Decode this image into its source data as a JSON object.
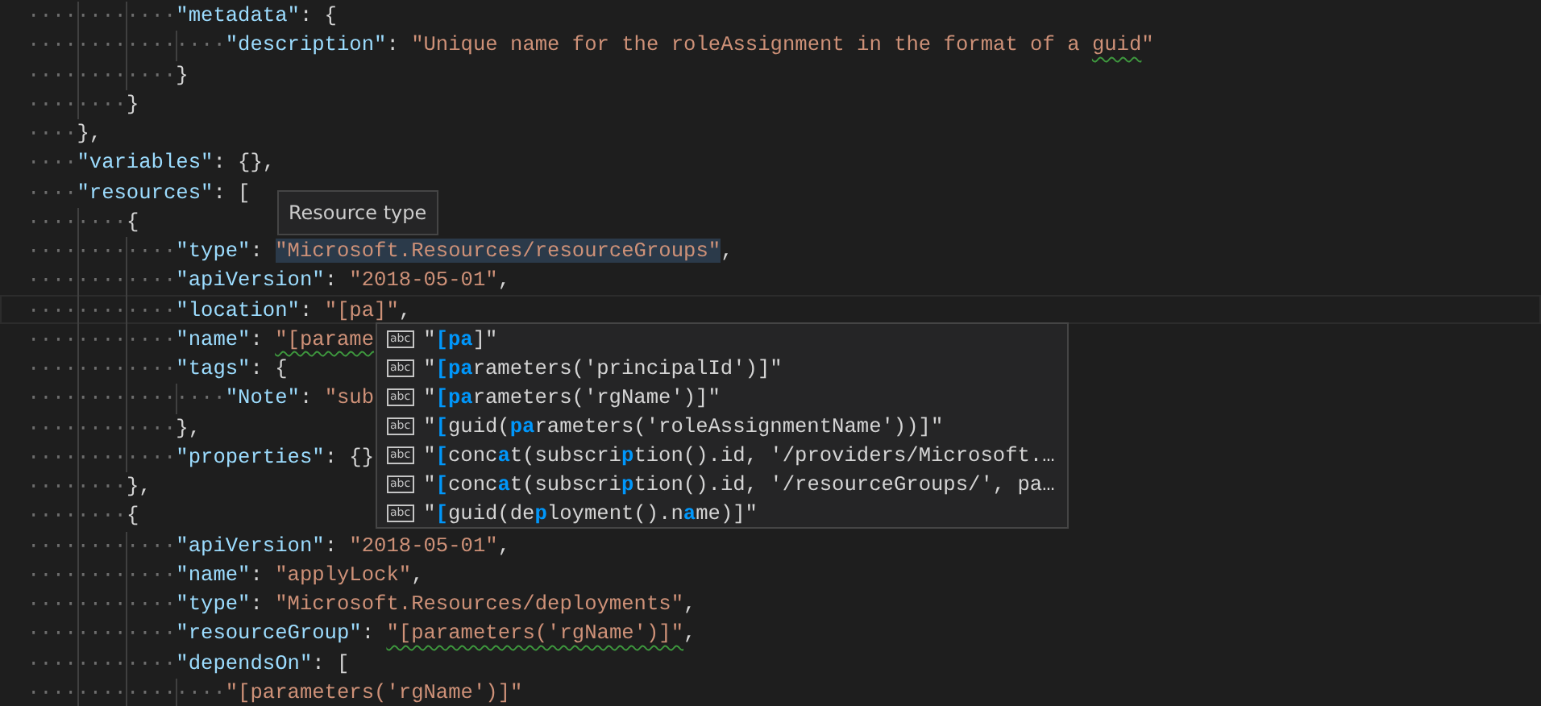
{
  "editor": {
    "lines": [
      {
        "current": false,
        "tokens": [
          {
            "kind": "ws",
            "text": "············"
          },
          {
            "kind": "key",
            "text": "\"metadata\""
          },
          {
            "kind": "punct",
            "text": ": {"
          }
        ]
      },
      {
        "current": false,
        "tokens": [
          {
            "kind": "ws",
            "text": "················"
          },
          {
            "kind": "key",
            "text": "\"description\""
          },
          {
            "kind": "punct",
            "text": ": "
          },
          {
            "kind": "string",
            "text": "\"Unique name for the roleAssignment in the format of a "
          },
          {
            "kind": "string",
            "text": "guid",
            "squiggle": true
          },
          {
            "kind": "string",
            "text": "\""
          }
        ]
      },
      {
        "current": false,
        "tokens": [
          {
            "kind": "ws",
            "text": "············"
          },
          {
            "kind": "punct",
            "text": "}"
          }
        ]
      },
      {
        "current": false,
        "tokens": [
          {
            "kind": "ws",
            "text": "········"
          },
          {
            "kind": "punct",
            "text": "}"
          }
        ]
      },
      {
        "current": false,
        "tokens": [
          {
            "kind": "ws",
            "text": "····"
          },
          {
            "kind": "punct",
            "text": "},"
          }
        ]
      },
      {
        "current": false,
        "tokens": [
          {
            "kind": "ws",
            "text": "····"
          },
          {
            "kind": "key",
            "text": "\"variables\""
          },
          {
            "kind": "punct",
            "text": ": {},"
          }
        ]
      },
      {
        "current": false,
        "tokens": [
          {
            "kind": "ws",
            "text": "····"
          },
          {
            "kind": "key",
            "text": "\"resources\""
          },
          {
            "kind": "punct",
            "text": ": ["
          }
        ]
      },
      {
        "current": false,
        "tokens": [
          {
            "kind": "ws",
            "text": "········"
          },
          {
            "kind": "punct",
            "text": "{"
          }
        ]
      },
      {
        "current": false,
        "tokens": [
          {
            "kind": "ws",
            "text": "············"
          },
          {
            "kind": "key",
            "text": "\"type\""
          },
          {
            "kind": "punct",
            "text": ": "
          },
          {
            "kind": "string",
            "text": "\"Microsoft.Resources/resourceGroups\"",
            "highlighted": true
          },
          {
            "kind": "punct",
            "text": ","
          }
        ]
      },
      {
        "current": false,
        "tokens": [
          {
            "kind": "ws",
            "text": "············"
          },
          {
            "kind": "key",
            "text": "\"apiVersion\""
          },
          {
            "kind": "punct",
            "text": ": "
          },
          {
            "kind": "string",
            "text": "\"2018-05-01\""
          },
          {
            "kind": "punct",
            "text": ","
          }
        ]
      },
      {
        "current": true,
        "tokens": [
          {
            "kind": "ws",
            "text": "············"
          },
          {
            "kind": "key",
            "text": "\"location\""
          },
          {
            "kind": "punct",
            "text": ": "
          },
          {
            "kind": "string",
            "text": "\"[pa]\""
          },
          {
            "kind": "punct",
            "text": ","
          }
        ]
      },
      {
        "current": false,
        "tokens": [
          {
            "kind": "ws",
            "text": "············"
          },
          {
            "kind": "key",
            "text": "\"name\""
          },
          {
            "kind": "punct",
            "text": ": "
          },
          {
            "kind": "string",
            "text": "\"[parame",
            "squiggle": true
          }
        ]
      },
      {
        "current": false,
        "tokens": [
          {
            "kind": "ws",
            "text": "············"
          },
          {
            "kind": "key",
            "text": "\"tags\""
          },
          {
            "kind": "punct",
            "text": ": {"
          }
        ]
      },
      {
        "current": false,
        "tokens": [
          {
            "kind": "ws",
            "text": "················"
          },
          {
            "kind": "key",
            "text": "\"Note\""
          },
          {
            "kind": "punct",
            "text": ": "
          },
          {
            "kind": "string",
            "text": "\"sub"
          }
        ]
      },
      {
        "current": false,
        "tokens": [
          {
            "kind": "ws",
            "text": "············"
          },
          {
            "kind": "punct",
            "text": "},"
          }
        ]
      },
      {
        "current": false,
        "tokens": [
          {
            "kind": "ws",
            "text": "············"
          },
          {
            "kind": "key",
            "text": "\"properties\""
          },
          {
            "kind": "punct",
            "text": ": {}"
          }
        ]
      },
      {
        "current": false,
        "tokens": [
          {
            "kind": "ws",
            "text": "········"
          },
          {
            "kind": "punct",
            "text": "},"
          }
        ]
      },
      {
        "current": false,
        "tokens": [
          {
            "kind": "ws",
            "text": "········"
          },
          {
            "kind": "punct",
            "text": "{"
          }
        ]
      },
      {
        "current": false,
        "tokens": [
          {
            "kind": "ws",
            "text": "············"
          },
          {
            "kind": "key",
            "text": "\"apiVersion\""
          },
          {
            "kind": "punct",
            "text": ": "
          },
          {
            "kind": "string",
            "text": "\"2018-05-01\""
          },
          {
            "kind": "punct",
            "text": ","
          }
        ]
      },
      {
        "current": false,
        "tokens": [
          {
            "kind": "ws",
            "text": "············"
          },
          {
            "kind": "key",
            "text": "\"name\""
          },
          {
            "kind": "punct",
            "text": ": "
          },
          {
            "kind": "string",
            "text": "\"applyLock\""
          },
          {
            "kind": "punct",
            "text": ","
          }
        ]
      },
      {
        "current": false,
        "tokens": [
          {
            "kind": "ws",
            "text": "············"
          },
          {
            "kind": "key",
            "text": "\"type\""
          },
          {
            "kind": "punct",
            "text": ": "
          },
          {
            "kind": "string",
            "text": "\"Microsoft.Resources/deployments\""
          },
          {
            "kind": "punct",
            "text": ","
          }
        ]
      },
      {
        "current": false,
        "tokens": [
          {
            "kind": "ws",
            "text": "············"
          },
          {
            "kind": "key",
            "text": "\"resourceGroup\""
          },
          {
            "kind": "punct",
            "text": ": "
          },
          {
            "kind": "string",
            "text": "\"[parameters('rgName')]\"",
            "squiggle": true
          },
          {
            "kind": "punct",
            "text": ","
          }
        ]
      },
      {
        "current": false,
        "tokens": [
          {
            "kind": "ws",
            "text": "············"
          },
          {
            "kind": "key",
            "text": "\"dependsOn\""
          },
          {
            "kind": "punct",
            "text": ": ["
          }
        ]
      },
      {
        "current": false,
        "tokens": [
          {
            "kind": "ws",
            "text": "················"
          },
          {
            "kind": "string",
            "text": "\"[parameters('rgName')]\""
          }
        ]
      }
    ]
  },
  "hover_tooltip": {
    "text": "Resource type"
  },
  "suggestions": [
    {
      "icon": "abc",
      "parts": [
        {
          "text": "\"",
          "match": false
        },
        {
          "text": "[pa",
          "match": true
        },
        {
          "text": "]\"",
          "match": false
        }
      ]
    },
    {
      "icon": "abc",
      "parts": [
        {
          "text": "\"",
          "match": false
        },
        {
          "text": "[pa",
          "match": true
        },
        {
          "text": "rameters('principalId')]\"",
          "match": false
        }
      ]
    },
    {
      "icon": "abc",
      "parts": [
        {
          "text": "\"",
          "match": false
        },
        {
          "text": "[pa",
          "match": true
        },
        {
          "text": "rameters('rgName')]\"",
          "match": false
        }
      ]
    },
    {
      "icon": "abc",
      "parts": [
        {
          "text": "\"",
          "match": false
        },
        {
          "text": "[",
          "match": true
        },
        {
          "text": "guid(",
          "match": false
        },
        {
          "text": "pa",
          "match": true
        },
        {
          "text": "rameters('roleAssignmentName'))]\"",
          "match": false
        }
      ]
    },
    {
      "icon": "abc",
      "parts": [
        {
          "text": "\"",
          "match": false
        },
        {
          "text": "[",
          "match": true
        },
        {
          "text": "conc",
          "match": false
        },
        {
          "text": "a",
          "match": true
        },
        {
          "text": "t(subscri",
          "match": false
        },
        {
          "text": "p",
          "match": true
        },
        {
          "text": "tion().id, '/providers/Microsoft.…",
          "match": false
        }
      ]
    },
    {
      "icon": "abc",
      "parts": [
        {
          "text": "\"",
          "match": false
        },
        {
          "text": "[",
          "match": true
        },
        {
          "text": "conc",
          "match": false
        },
        {
          "text": "a",
          "match": true
        },
        {
          "text": "t(subscri",
          "match": false
        },
        {
          "text": "p",
          "match": true
        },
        {
          "text": "tion().id, '/resourceGroups/', pa…",
          "match": false
        }
      ]
    },
    {
      "icon": "abc",
      "parts": [
        {
          "text": "\"",
          "match": false
        },
        {
          "text": "[",
          "match": true
        },
        {
          "text": "guid(de",
          "match": false
        },
        {
          "text": "p",
          "match": true
        },
        {
          "text": "loyment().n",
          "match": false
        },
        {
          "text": "a",
          "match": true
        },
        {
          "text": "me)]\"",
          "match": false
        }
      ]
    }
  ]
}
